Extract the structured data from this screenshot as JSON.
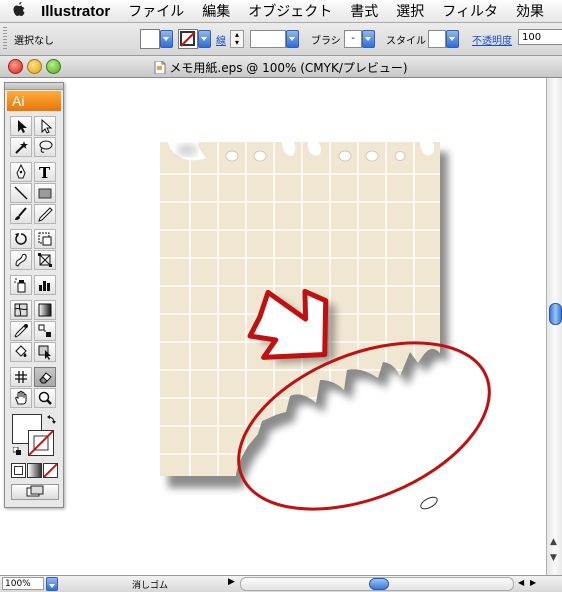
{
  "menubar": {
    "app_name": "Illustrator",
    "items": [
      "ファイル",
      "編集",
      "オブジェクト",
      "書式",
      "選択",
      "フィルタ",
      "効果"
    ]
  },
  "control_bar": {
    "selection_label": "選択なし",
    "stroke_label": "線",
    "brush_label": "ブラシ",
    "brush_value": "-",
    "style_label": "スタイル",
    "opacity_label": "不透明度",
    "opacity_value": "100"
  },
  "window": {
    "title": "メモ用紙.eps @ 100% (CMYK/プレビュー)"
  },
  "tools_panel": {
    "logo_text": "Ai"
  },
  "status_bar": {
    "zoom_value": "100%",
    "tool_name": "消しゴム"
  },
  "colors": {
    "paper": "#f0e6d2",
    "grid_line": "#ffffff",
    "annotation_red": "#c01010",
    "accent_blue": "#2f6fd8",
    "logo_orange": "#f08a1c"
  }
}
